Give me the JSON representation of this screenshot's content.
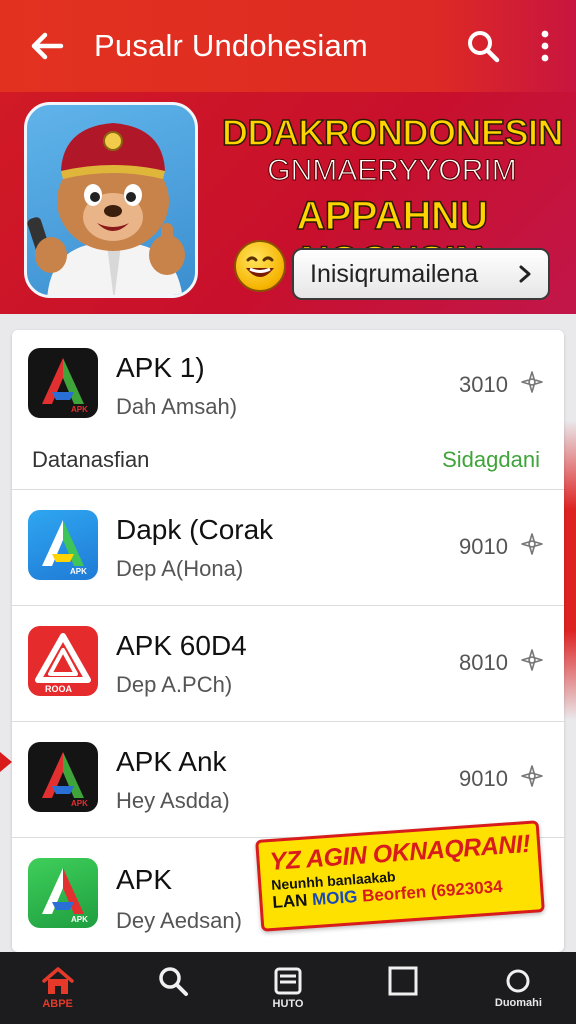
{
  "appbar": {
    "title": "Pusalr Undohesiam",
    "back_icon": "arrow-left-icon",
    "search_icon": "search-icon",
    "more_icon": "more-vert-icon",
    "colors": {
      "bar": "#e2321f",
      "bar_end": "#c8153f"
    }
  },
  "banner": {
    "headline_1": "DDAKRONDONESIN",
    "headline_2": "GNMAERYYORIM",
    "headline_3": "APPAHNU NOONSIN",
    "cta_label": "Inisiqrumailena",
    "cta_icon": "chevron-right-icon",
    "mascot": "mascot-character-image",
    "colors": {
      "headline": "#ffd400",
      "background": "#c8102c"
    }
  },
  "apps": [
    {
      "name": "APK 1)",
      "subtitle": "Dah Amsah)",
      "count": "3010",
      "icon": "apk-logo-dark"
    },
    {
      "name": "Dapk (Corak",
      "subtitle": "Dep A(Hona)",
      "count": "9010",
      "icon": "apk-logo-blue"
    },
    {
      "name": "APK 60D4",
      "subtitle": "Dep A.PCh)",
      "count": "8010",
      "icon": "apk-logo-red"
    },
    {
      "name": "APK Ank",
      "subtitle": "Hey Asdda)",
      "count": "9010",
      "icon": "apk-logo-dark"
    },
    {
      "name": "APK",
      "subtitle": "Dey Aedsan)",
      "count": "",
      "icon": "apk-logo-green"
    }
  ],
  "first_row_footer": {
    "left": "Datanasfian",
    "right": "Sidagdani",
    "right_color": "#3fa43a"
  },
  "promo": {
    "line_1": "YZ AGIN OKNAQRANI!",
    "line_2": "Neunhh banlaakab",
    "line_3_a": "LAN",
    "line_3_b": "MOIG",
    "line_3_c": "Beorfen (6923034",
    "colors": {
      "background": "#ffe100",
      "accent": "#d81c1c"
    }
  },
  "bottomnav": {
    "items": [
      {
        "label": "ABPE",
        "icon": "home-icon",
        "active": true
      },
      {
        "label": "",
        "icon": "search-icon",
        "active": false
      },
      {
        "label": "HUTO",
        "icon": "library-icon",
        "active": false
      },
      {
        "label": "",
        "icon": "square-icon",
        "active": false
      },
      {
        "label": "Duomahi",
        "icon": "circle-icon",
        "active": false
      }
    ],
    "colors": {
      "active": "#e53a2a",
      "background": "#1c1c1e"
    }
  },
  "star_icon": "star-outline-icon"
}
